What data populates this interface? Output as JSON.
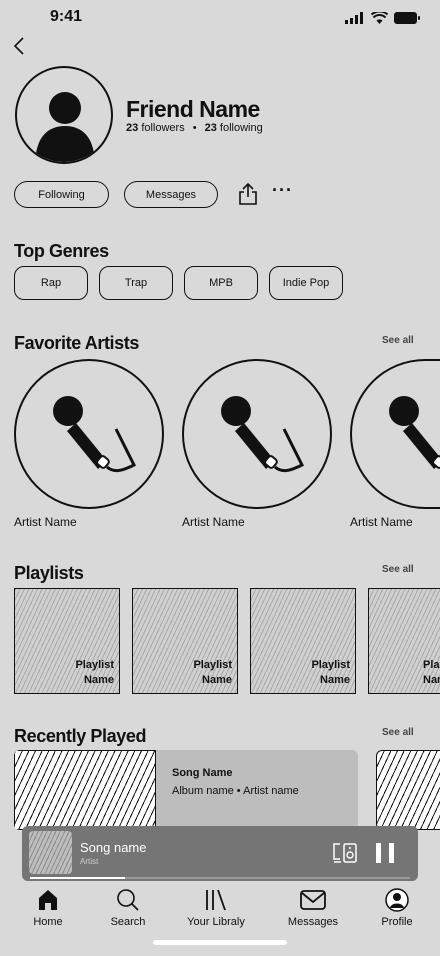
{
  "status": {
    "time": "9:41"
  },
  "profile": {
    "name": "Friend Name",
    "followers_count": "23",
    "followers_label": "followers",
    "separator": "•",
    "following_count": "23",
    "following_label": "following"
  },
  "actions": {
    "following_label": "Following",
    "messages_label": "Messages",
    "more_label": "···"
  },
  "top_genres": {
    "title": "Top Genres",
    "items": [
      "Rap",
      "Trap",
      "MPB",
      "Indie Pop"
    ]
  },
  "favorite_artists": {
    "title": "Favorite Artists",
    "see_all": "See all",
    "items": [
      "Artist Name",
      "Artist Name",
      "Artist Name"
    ]
  },
  "playlists": {
    "title": "Playlists",
    "see_all": "See all",
    "items": [
      {
        "line1": "Playlist",
        "line2": "Name"
      },
      {
        "line1": "Playlist",
        "line2": "Name"
      },
      {
        "line1": "Playlist",
        "line2": "Name"
      },
      {
        "line1": "Playlist",
        "line2": "Name"
      }
    ]
  },
  "recently_played": {
    "title": "Recently Played",
    "see_all": "See all",
    "song": "Song Name",
    "meta": "Album name • Artist name"
  },
  "player": {
    "song": "Song name",
    "artist": "Artist",
    "progress": 0.25
  },
  "nav": {
    "home": "Home",
    "search": "Search",
    "library": "Your Libraly",
    "messages": "Messages",
    "profile": "Profile"
  },
  "icons": {
    "back": "chevron-left-icon",
    "share": "share-icon",
    "microphone": "microphone-icon",
    "devices": "devices-icon",
    "pause": "pause-icon"
  }
}
